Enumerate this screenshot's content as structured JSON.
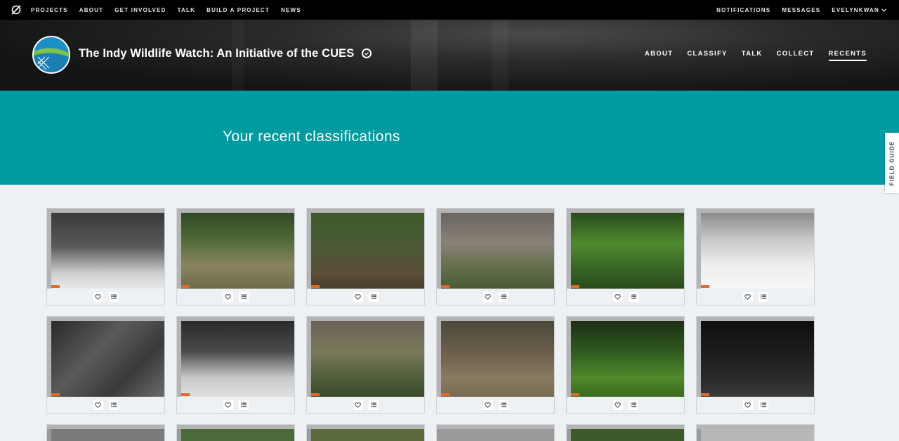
{
  "topnav": {
    "links": [
      "PROJECTS",
      "ABOUT",
      "GET INVOLVED",
      "TALK",
      "BUILD A PROJECT",
      "NEWS"
    ],
    "right": [
      "NOTIFICATIONS",
      "MESSAGES",
      "EVELYNKWAN"
    ]
  },
  "project": {
    "title": "The Indy Wildlife Watch: An Initiative of the CUES",
    "nav": [
      "ABOUT",
      "CLASSIFY",
      "TALK",
      "COLLECT",
      "RECENTS"
    ],
    "active_nav": "RECENTS"
  },
  "banner": {
    "heading": "Your recent classifications"
  },
  "field_guide": {
    "label": "FIELD GUIDE"
  },
  "colors": {
    "teal": "#009ba1",
    "topbar": "#000000",
    "tag": "#e06a2a"
  },
  "classifications": [
    {
      "scene": "ir-night-bush",
      "icons": [
        "heart-icon",
        "list-icon"
      ]
    },
    {
      "scene": "day-green-clearing",
      "icons": [
        "heart-icon",
        "list-icon"
      ]
    },
    {
      "scene": "day-dense-brush",
      "icons": [
        "heart-icon",
        "list-icon"
      ]
    },
    {
      "scene": "day-tree-trunk-leaves",
      "icons": [
        "heart-icon",
        "list-icon"
      ]
    },
    {
      "scene": "day-green-leaves",
      "icons": [
        "heart-icon",
        "list-icon"
      ]
    },
    {
      "scene": "ir-bright-clearing",
      "icons": [
        "heart-icon",
        "list-icon"
      ]
    },
    {
      "scene": "ir-fallen-trunks",
      "icons": [
        "heart-icon",
        "list-icon"
      ]
    },
    {
      "scene": "ir-night-trunk",
      "icons": [
        "heart-icon",
        "list-icon"
      ]
    },
    {
      "scene": "day-trunk-ground",
      "icons": [
        "heart-icon",
        "list-icon"
      ]
    },
    {
      "scene": "day-goose",
      "icons": [
        "heart-icon",
        "list-icon"
      ]
    },
    {
      "scene": "day-green-forest",
      "icons": [
        "heart-icon",
        "list-icon"
      ]
    },
    {
      "scene": "ir-dark-forest",
      "icons": [
        "heart-icon",
        "list-icon"
      ]
    }
  ]
}
